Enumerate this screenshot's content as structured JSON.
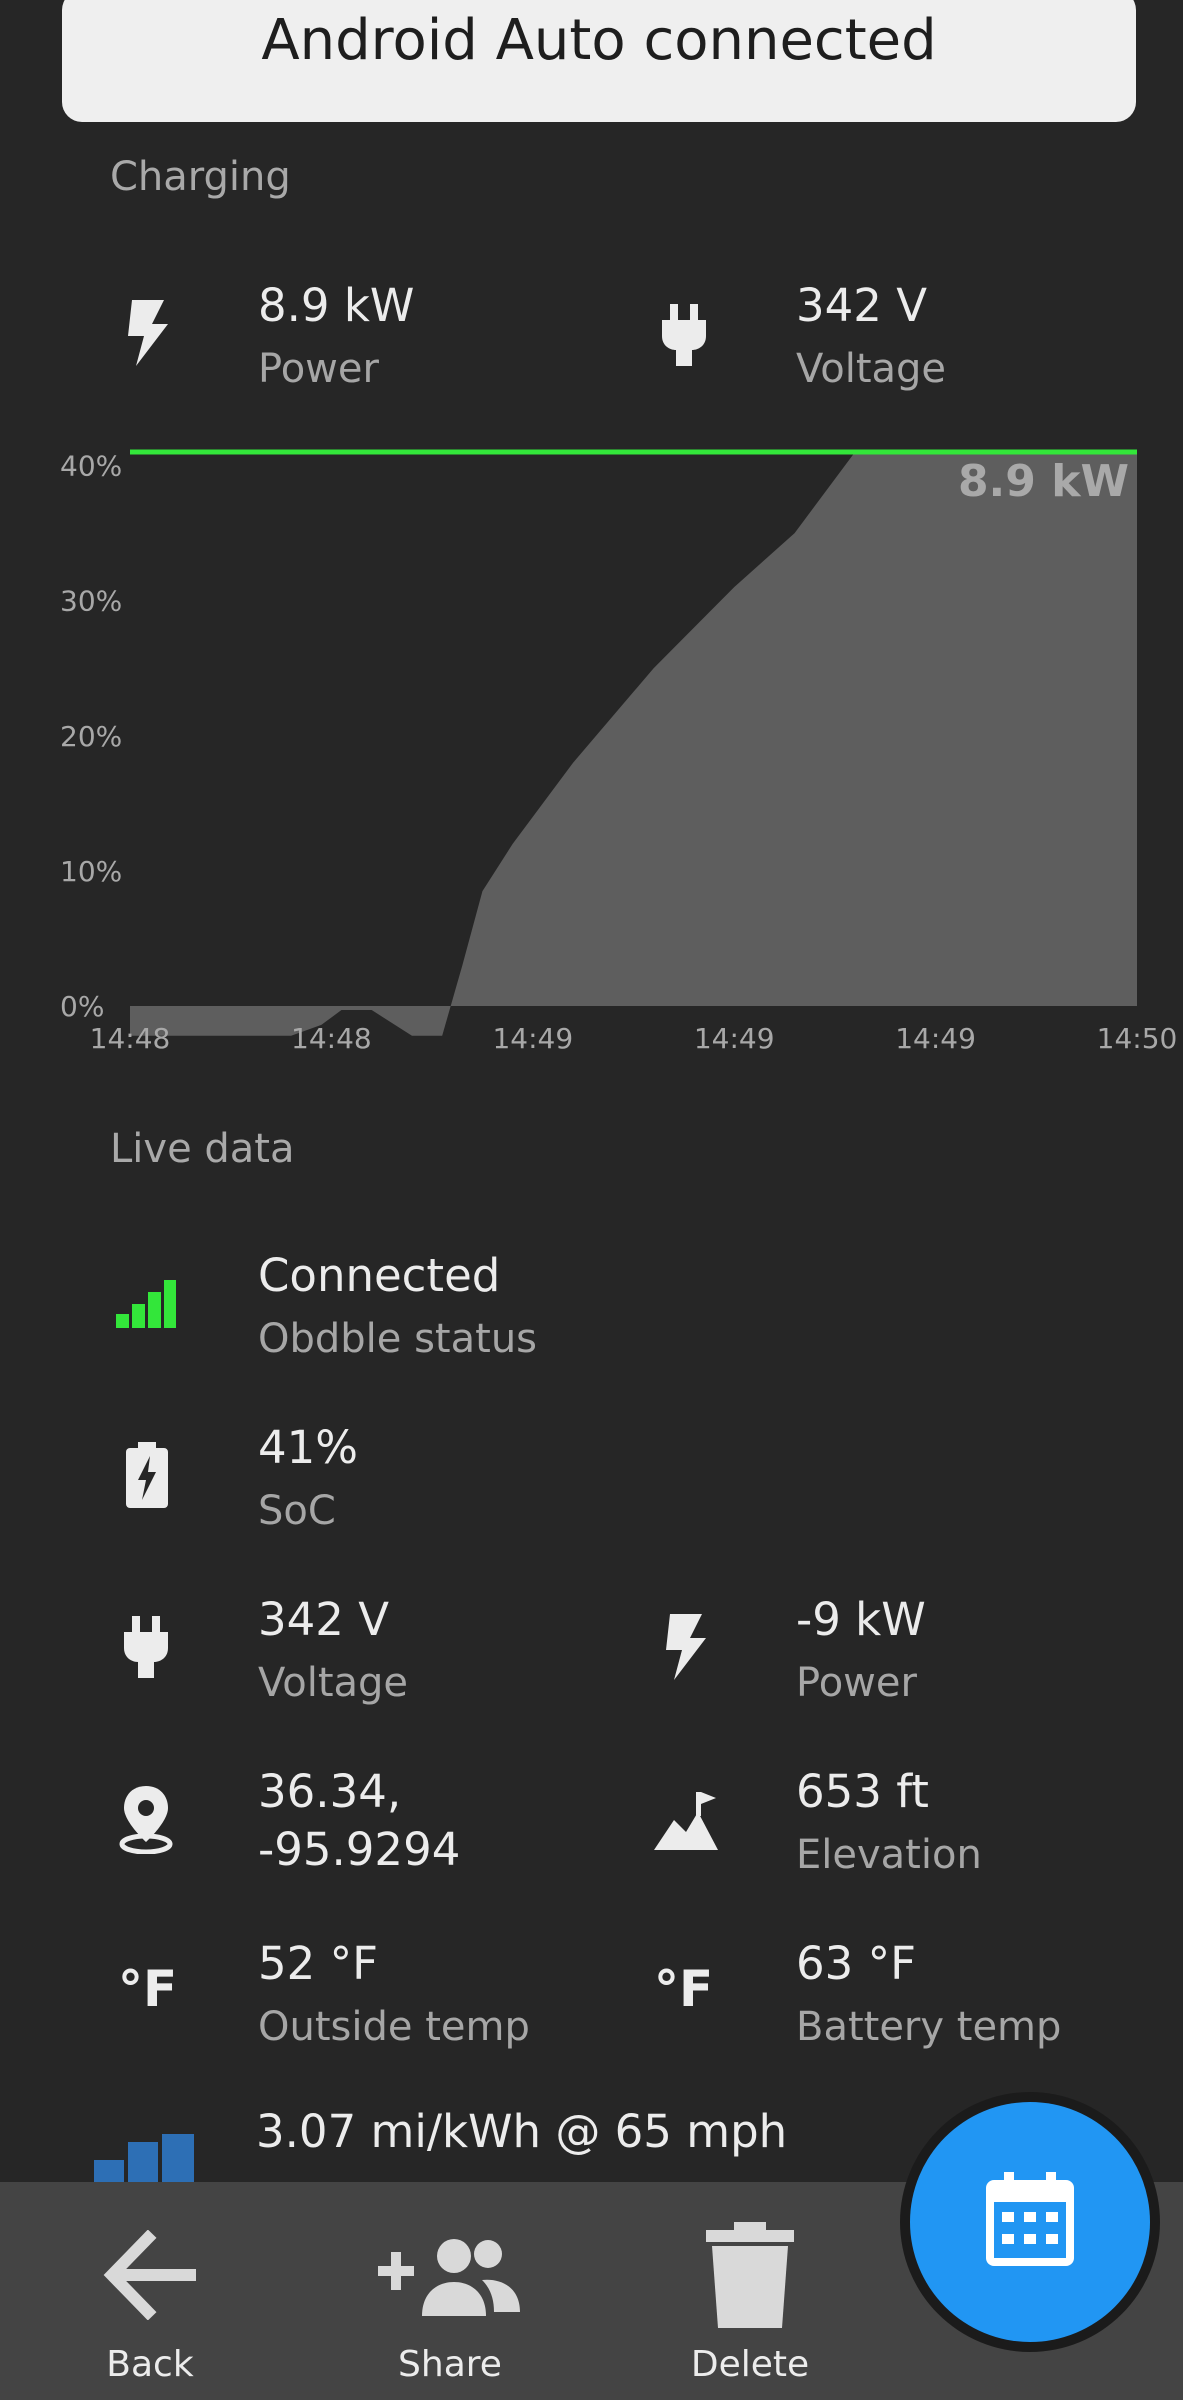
{
  "toast": {
    "text": "Android Auto connected"
  },
  "charging": {
    "section_label": "Charging",
    "power": {
      "value": "8.9 kW",
      "label": "Power"
    },
    "voltage": {
      "value": "342 V",
      "label": "Voltage"
    }
  },
  "chart_data": {
    "type": "area",
    "title": "",
    "xlabel": "",
    "ylabel": "",
    "x_ticks": [
      "14:48",
      "14:48",
      "14:49",
      "14:49",
      "14:49",
      "14:50"
    ],
    "y_ticks": [
      "40%",
      "30%",
      "20%",
      "10%",
      "0%"
    ],
    "ylim": [
      0,
      41
    ],
    "xlim": [
      0,
      5
    ],
    "current_line": {
      "value": 41,
      "label": "8.9 kW",
      "color": "#33e63a"
    },
    "series": [
      {
        "color": "#5e5e5e",
        "x": [
          0,
          0.4,
          0.8,
          0.95,
          1.05,
          1.2,
          1.4,
          1.55,
          1.65,
          1.75,
          1.9,
          2.2,
          2.6,
          3.0,
          3.3,
          3.6,
          4.0,
          5.0
        ],
        "values": [
          -2.2,
          -2.2,
          -2.2,
          -1.4,
          -0.3,
          -0.3,
          -2.2,
          -2.2,
          3.0,
          8.5,
          12.0,
          18.0,
          25.0,
          31.0,
          35.0,
          41.0,
          41.0,
          41.0
        ]
      }
    ]
  },
  "live_data": {
    "section_label": "Live data",
    "connection": {
      "value": "Connected",
      "label": "Obdble status"
    },
    "soc": {
      "value": "41%",
      "label": "SoC"
    },
    "voltage": {
      "value": "342 V",
      "label": "Voltage"
    },
    "power": {
      "value": "-9 kW",
      "label": "Power"
    },
    "location": {
      "value_line1": "36.34,",
      "value_line2": "-95.9294"
    },
    "elevation": {
      "value": "653 ft",
      "label": "Elevation"
    },
    "outside_temp": {
      "value": "52 °F",
      "label": "Outside temp"
    },
    "battery_temp": {
      "value": "63 °F",
      "label": "Battery temp"
    },
    "efficiency": {
      "value": "3.07 mi/kWh @ 65 mph"
    }
  },
  "icons": {
    "temp_glyph": "°F"
  },
  "bottom_nav": {
    "back": "Back",
    "share": "Share",
    "delete": "Delete"
  },
  "colors": {
    "background": "#262626",
    "accent_green": "#33e63a",
    "fab_blue": "#2196f3",
    "area_fill": "#5e5e5e"
  }
}
